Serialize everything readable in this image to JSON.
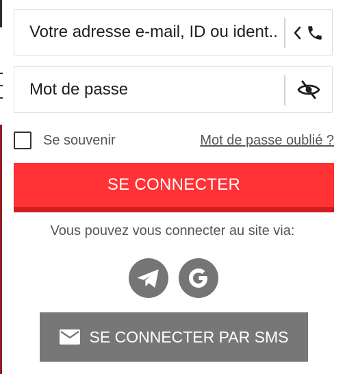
{
  "login_form": {
    "email_field": {
      "placeholder": "Votre adresse e-mail, ID ou ident.."
    },
    "password_field": {
      "placeholder": "Mot de passe"
    },
    "remember_label": "Se souvenir",
    "forgot_password_link": "Mot de passe oublié ?",
    "login_button": "SE CONNECTER",
    "via_text": "Vous pouvez vous connecter au site via:",
    "social_logins": [
      {
        "icon": "telegram-icon"
      },
      {
        "icon": "google-icon"
      }
    ],
    "sms_button": {
      "label": "SE CONNECTER PAR SMS",
      "icon": "envelope-icon"
    }
  },
  "colors": {
    "primary_red": "#ff3235",
    "primary_red_shadow": "#cf1e22",
    "social_grey": "#757575",
    "sms_grey": "#777777"
  }
}
